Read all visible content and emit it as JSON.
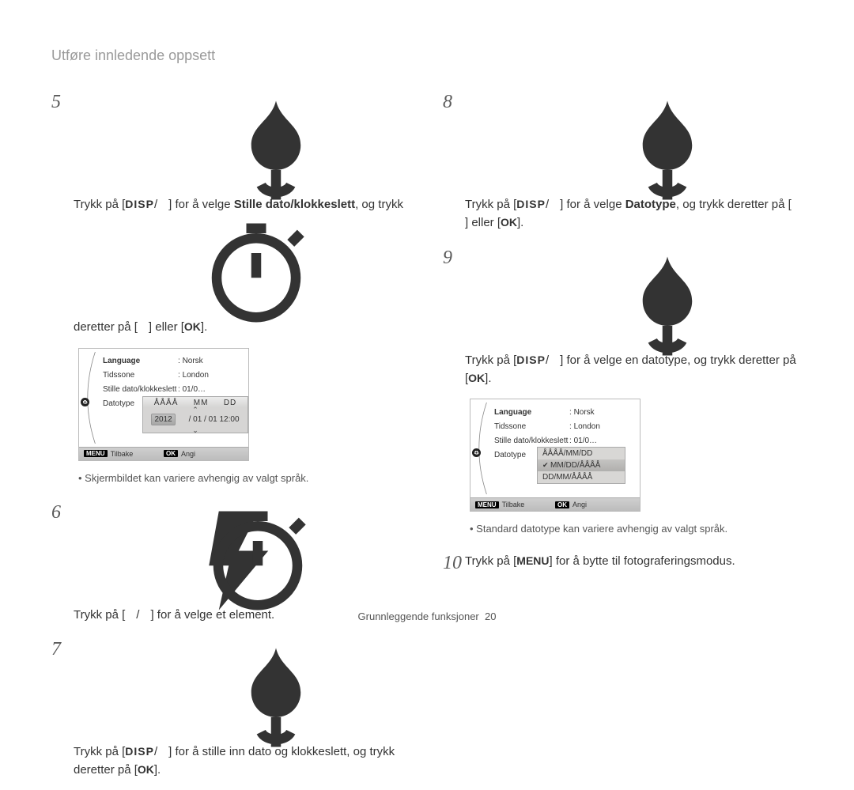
{
  "header": "Utføre innledende oppsett",
  "buttons": {
    "disp": "DISP",
    "ok": "OK",
    "menu": "MENU",
    "slash": "/"
  },
  "steps": {
    "s5a": "Trykk på [",
    "s5b": "] for å velge ",
    "s5bold": "Stille dato/klokkeslett",
    "s5c": ", og trykk deretter på [",
    "s5d": "] eller [",
    "s5e": "].",
    "s6a": "Trykk på [",
    "s6b": "] for å velge et element.",
    "s7a": "Trykk på [",
    "s7b": "] for å stille inn dato og klokkeslett, og trykk deretter på [",
    "s7c": "].",
    "s8a": "Trykk på [",
    "s8b": "] for å velge ",
    "s8bold": "Datotype",
    "s8c": ", og trykk deretter på [",
    "s8d": "] eller [",
    "s8e": "].",
    "s9a": "Trykk på [",
    "s9b": "] for å velge en datotype, og trykk deretter på [",
    "s9c": "].",
    "s10a": "Trykk på [",
    "s10b": "] for å bytte til fotograferingsmodus."
  },
  "notes": {
    "n1": "Skjermbildet kan variere avhengig av valgt språk.",
    "n2": "Standard datotype kan variere avhengig av valgt språk."
  },
  "lcd": {
    "language_label": "Language",
    "language_value": "Norsk",
    "timezone_label": "Tidssone",
    "timezone_value": "London",
    "datetime_label": "Stille dato/klokkeslett",
    "datetime_value": "01/0…",
    "datetype_label": "Datotype",
    "date_hdr_y": "ÅÅÅÅ",
    "date_hdr_m": "MM",
    "date_hdr_d": "DD",
    "date_year": "2012",
    "date_rest": "/ 01 / 01 12:00",
    "type_opt1": "ÅÅÅÅ/MM/DD",
    "type_opt2": "MM/DD/ÅÅÅÅ",
    "type_opt3": "DD/MM/ÅÅÅÅ",
    "footer_back_tag": "MENU",
    "footer_back": "Tilbake",
    "footer_set_tag": "OK",
    "footer_set": "Angi"
  },
  "footer": {
    "section": "Grunnleggende funksjoner",
    "page": "20"
  }
}
